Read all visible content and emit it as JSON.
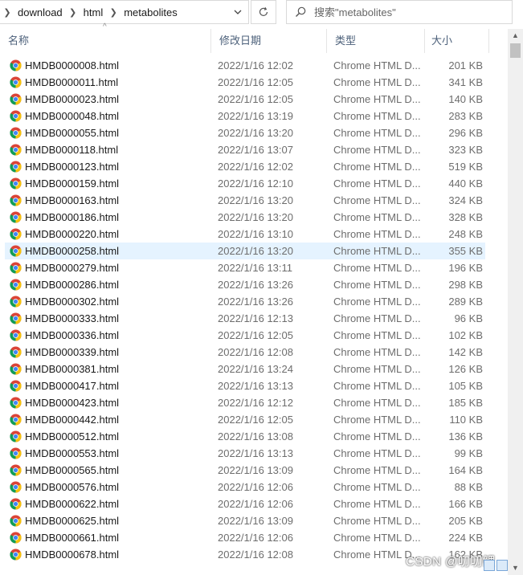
{
  "address_bar": {
    "breadcrumbs": [
      "download",
      "html",
      "metabolites"
    ]
  },
  "search": {
    "placeholder": "搜索\"metabolites\""
  },
  "columns": {
    "name": "名称",
    "date": "修改日期",
    "type": "类型",
    "size": "大小"
  },
  "files": [
    {
      "name": "HMDB0000008.html",
      "date": "2022/1/16 12:02",
      "type": "Chrome HTML D...",
      "size": "201 KB"
    },
    {
      "name": "HMDB0000011.html",
      "date": "2022/1/16 12:05",
      "type": "Chrome HTML D...",
      "size": "341 KB"
    },
    {
      "name": "HMDB0000023.html",
      "date": "2022/1/16 12:05",
      "type": "Chrome HTML D...",
      "size": "140 KB"
    },
    {
      "name": "HMDB0000048.html",
      "date": "2022/1/16 13:19",
      "type": "Chrome HTML D...",
      "size": "283 KB"
    },
    {
      "name": "HMDB0000055.html",
      "date": "2022/1/16 13:20",
      "type": "Chrome HTML D...",
      "size": "296 KB"
    },
    {
      "name": "HMDB0000118.html",
      "date": "2022/1/16 13:07",
      "type": "Chrome HTML D...",
      "size": "323 KB"
    },
    {
      "name": "HMDB0000123.html",
      "date": "2022/1/16 12:02",
      "type": "Chrome HTML D...",
      "size": "519 KB"
    },
    {
      "name": "HMDB0000159.html",
      "date": "2022/1/16 12:10",
      "type": "Chrome HTML D...",
      "size": "440 KB"
    },
    {
      "name": "HMDB0000163.html",
      "date": "2022/1/16 13:20",
      "type": "Chrome HTML D...",
      "size": "324 KB"
    },
    {
      "name": "HMDB0000186.html",
      "date": "2022/1/16 13:20",
      "type": "Chrome HTML D...",
      "size": "328 KB"
    },
    {
      "name": "HMDB0000220.html",
      "date": "2022/1/16 13:10",
      "type": "Chrome HTML D...",
      "size": "248 KB"
    },
    {
      "name": "HMDB0000258.html",
      "date": "2022/1/16 13:20",
      "type": "Chrome HTML D...",
      "size": "355 KB",
      "selected": true
    },
    {
      "name": "HMDB0000279.html",
      "date": "2022/1/16 13:11",
      "type": "Chrome HTML D...",
      "size": "196 KB"
    },
    {
      "name": "HMDB0000286.html",
      "date": "2022/1/16 13:26",
      "type": "Chrome HTML D...",
      "size": "298 KB"
    },
    {
      "name": "HMDB0000302.html",
      "date": "2022/1/16 13:26",
      "type": "Chrome HTML D...",
      "size": "289 KB"
    },
    {
      "name": "HMDB0000333.html",
      "date": "2022/1/16 12:13",
      "type": "Chrome HTML D...",
      "size": "96 KB"
    },
    {
      "name": "HMDB0000336.html",
      "date": "2022/1/16 12:05",
      "type": "Chrome HTML D...",
      "size": "102 KB"
    },
    {
      "name": "HMDB0000339.html",
      "date": "2022/1/16 12:08",
      "type": "Chrome HTML D...",
      "size": "142 KB"
    },
    {
      "name": "HMDB0000381.html",
      "date": "2022/1/16 13:24",
      "type": "Chrome HTML D...",
      "size": "126 KB"
    },
    {
      "name": "HMDB0000417.html",
      "date": "2022/1/16 13:13",
      "type": "Chrome HTML D...",
      "size": "105 KB"
    },
    {
      "name": "HMDB0000423.html",
      "date": "2022/1/16 12:12",
      "type": "Chrome HTML D...",
      "size": "185 KB"
    },
    {
      "name": "HMDB0000442.html",
      "date": "2022/1/16 12:05",
      "type": "Chrome HTML D...",
      "size": "110 KB"
    },
    {
      "name": "HMDB0000512.html",
      "date": "2022/1/16 13:08",
      "type": "Chrome HTML D...",
      "size": "136 KB"
    },
    {
      "name": "HMDB0000553.html",
      "date": "2022/1/16 13:13",
      "type": "Chrome HTML D...",
      "size": "99 KB"
    },
    {
      "name": "HMDB0000565.html",
      "date": "2022/1/16 13:09",
      "type": "Chrome HTML D...",
      "size": "164 KB"
    },
    {
      "name": "HMDB0000576.html",
      "date": "2022/1/16 12:06",
      "type": "Chrome HTML D...",
      "size": "88 KB"
    },
    {
      "name": "HMDB0000622.html",
      "date": "2022/1/16 12:06",
      "type": "Chrome HTML D...",
      "size": "166 KB"
    },
    {
      "name": "HMDB0000625.html",
      "date": "2022/1/16 13:09",
      "type": "Chrome HTML D...",
      "size": "205 KB"
    },
    {
      "name": "HMDB0000661.html",
      "date": "2022/1/16 12:06",
      "type": "Chrome HTML D...",
      "size": "224 KB"
    },
    {
      "name": "HMDB0000678.html",
      "date": "2022/1/16 12:08",
      "type": "Chrome HTML D...",
      "size": "162 KB"
    }
  ],
  "watermark": "CSDN @叨叨鲤",
  "colors": {
    "selected_row": "#e5f3ff",
    "header_text": "#4c607a",
    "meta_text": "#6d6d6d"
  },
  "icons": {
    "file": "chrome-icon",
    "search": "search-icon",
    "refresh": "refresh-icon",
    "dropdown": "chevron-down-icon"
  }
}
